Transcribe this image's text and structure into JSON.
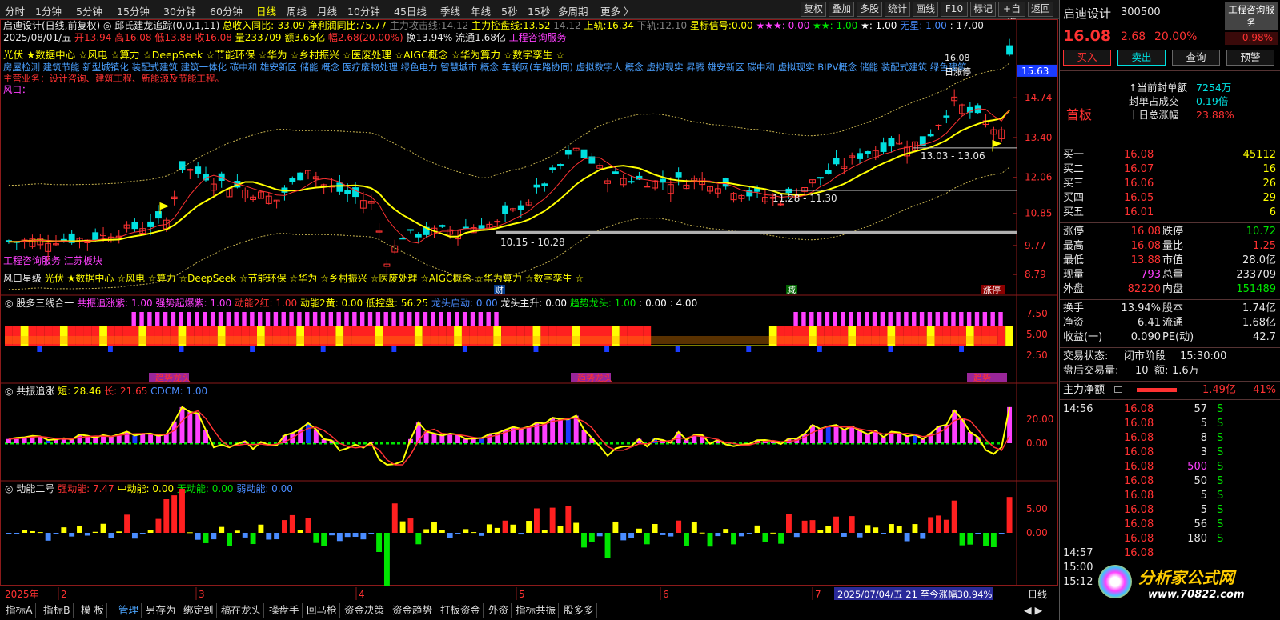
{
  "toolbar": {
    "periods": [
      "分时",
      "1分钟",
      "5分钟",
      "15分钟",
      "30分钟",
      "60分钟",
      "日线",
      "周线",
      "月线",
      "10分钟",
      "45日线",
      "季线",
      "年线",
      "5秒",
      "15秒",
      "多周期",
      "更多 〉"
    ],
    "active_period": "日线",
    "right_buttons": [
      "复权",
      "叠加",
      "多股",
      "统计",
      "画线",
      "F10",
      "标记",
      "+自选",
      "返回"
    ]
  },
  "stock": {
    "name": "启迪设计",
    "code": "300500",
    "chart_title": "启迪设计(日线,前复权)",
    "indicator_line": "邱氏建龙追踪(0,0,1,11)",
    "metrics_line1": [
      {
        "label": "总收入同比:",
        "value": "-33.09",
        "color": "#ffff00"
      },
      {
        "label": "净利润同比:",
        "value": "75.77",
        "color": "#ffff00"
      },
      {
        "label": "主力攻击线:",
        "value": "14.12",
        "color": "#808080"
      },
      {
        "label": "主力控盘线:",
        "value": "13.52",
        "color": "#ffff00"
      },
      {
        "label": "",
        "value": "14.12",
        "color": "#808080"
      },
      {
        "label": "上轨:",
        "value": "16.34",
        "color": "#ffff00"
      },
      {
        "label": "下轨:",
        "value": "12.10",
        "color": "#808080"
      },
      {
        "label": "星标信号:",
        "value": "0.00",
        "color": "#ffff00"
      }
    ],
    "stars": [
      {
        "text": "★★★:",
        "value": "0.00",
        "color": "#ff40ff"
      },
      {
        "text": "★★:",
        "value": "1.00",
        "color": "#00e600"
      },
      {
        "text": "★:",
        "value": "1.00",
        "color": "#ffffff"
      },
      {
        "text": "无星:",
        "value": "1.00",
        "color": "#4a8cff"
      }
    ],
    "extra_value": "17.00",
    "date_line": "2025/08/01/五",
    "ohlc": {
      "open": "13.94",
      "high": "16.08",
      "low": "13.88",
      "close": "16.08",
      "volume": "233709",
      "amount": "3.65亿",
      "change_pct": "2.68(20.00%)",
      "turnover": "13.94%",
      "float_shares": "1.68亿",
      "sector": "工程咨询服务"
    },
    "concepts_line": "光伏 ★数据中心 ☆风电 ☆算力 ☆DeepSeek ☆节能环保 ☆华为 ☆乡村振兴 ☆医废处理 ☆AIGC概念 ☆华为算力 ☆数字孪生 ☆",
    "tags_line": "房屋检测 建筑节能 新型城镇化 装配式建筑 建筑一体化 碳中和 雄安新区 储能 概念 医疗废物处理 绿色电力 智慧城市 概念 车联网(车路协同) 虚拟数字人 概念 虚拟现实 昇腾 雄安新区 碳中和 虚拟现实 BIPV概念 储能 装配式建筑 绿色建筑",
    "business": "主营业务：设计咨询、建筑工程、新能源及节能工程。",
    "wind": "风口：",
    "sector_tag": "工程咨询服务 江苏板块",
    "wind_tags_label": "风口星级",
    "wind_tags": "光伏 ★数据中心 ☆风电 ☆算力 ☆DeepSeek ☆节能环保 ☆华为 ☆乡村振兴 ☆医废处理 ☆AIGC概念 ☆华为算力 ☆数字孪生 ☆"
  },
  "price_axis": [
    "15.63",
    "14.74",
    "13.40",
    "12.06",
    "10.85",
    "9.77",
    "8.79"
  ],
  "price_axis_top": "15.63",
  "annotations": {
    "high": "16.08",
    "range1": "13.03 - 13.06",
    "range2": "11.28 - 11.30",
    "range3": "10.15 - 10.28",
    "mark_cai": "财",
    "mark_jian": "减",
    "mark_zhangting": "涨停",
    "rizhangting": "日涨停"
  },
  "panel2": {
    "title": "股多三线合一",
    "items": [
      {
        "label": "共振追涨紫:",
        "value": "1.00",
        "color": "#ff40ff"
      },
      {
        "label": "强势起爆紫:",
        "value": "1.00",
        "color": "#ff40ff"
      },
      {
        "label": "动能2红:",
        "value": "1.00",
        "color": "#ff3232"
      },
      {
        "label": "动能2黄:",
        "value": "0.00",
        "color": "#ffff00"
      },
      {
        "label": "低控盘:",
        "value": "56.25",
        "color": "#ffff00"
      },
      {
        "label": "龙头启动:",
        "value": "0.00",
        "color": "#4a8cff"
      },
      {
        "label": "龙头主升:",
        "value": "0.00",
        "color": "#ffffff"
      },
      {
        "label": "趋势龙头:",
        "value": "1.00",
        "color": "#00e600"
      },
      {
        "label": ":",
        "value": "0.00",
        "color": "#ffffff"
      },
      {
        "label": ":",
        "value": "4.00",
        "color": "#ffffff"
      }
    ],
    "axis": [
      "7.50",
      "5.00",
      "2.50"
    ],
    "labels": [
      "趋势龙头",
      "趋势龙头",
      "趋势"
    ]
  },
  "panel3": {
    "title": "共振追涨",
    "items": [
      {
        "label": "短:",
        "value": "28.46",
        "color": "#ffff00"
      },
      {
        "label": "长:",
        "value": "21.65",
        "color": "#ff3232"
      },
      {
        "label": "CDCM:",
        "value": "1.00",
        "color": "#4a8cff"
      }
    ],
    "axis": [
      "20.00",
      "0.00"
    ]
  },
  "panel4": {
    "title": "动能二号",
    "items": [
      {
        "label": "强动能:",
        "value": "7.47",
        "color": "#ff3232"
      },
      {
        "label": "中动能:",
        "value": "0.00",
        "color": "#ffff00"
      },
      {
        "label": "无动能:",
        "value": "0.00",
        "color": "#00e600"
      },
      {
        "label": "弱动能:",
        "value": "0.00",
        "color": "#4a8cff"
      }
    ],
    "axis": [
      "5.00",
      "0.00"
    ]
  },
  "time_axis": {
    "year": "2025年",
    "months": [
      "2",
      "3",
      "4",
      "5",
      "6",
      "7"
    ],
    "info": "2025/07/04/五 21 至今涨幅30.94%",
    "period_label": "日线"
  },
  "bottom_tabs": [
    "指标A",
    "指标B",
    "模 板",
    "管理",
    "另存为",
    "绑定到",
    "稿在龙头",
    "操盘手",
    "回马枪",
    "资金决策",
    "资金趋势",
    "打板资金",
    "外资",
    "指标共振",
    "股多多"
  ],
  "bottom_active": "管理",
  "right_panel": {
    "name": "启迪设计",
    "code": "300500",
    "price": "16.08",
    "change": "2.68",
    "pct": "20.00%",
    "corner_label": "工程咨询服务",
    "corner_pct": "0.98%",
    "buttons": [
      "买入",
      "卖出",
      "查询",
      "预警"
    ],
    "fb_label": "首板",
    "seal_rows": [
      {
        "label": "当前封单额",
        "value": "7254万"
      },
      {
        "label": "封单占成交",
        "value": "0.19倍"
      },
      {
        "label": "十日总涨幅",
        "value": "23.88%"
      }
    ],
    "bids": [
      {
        "label": "买一",
        "price": "16.08",
        "vol": "45112"
      },
      {
        "label": "买二",
        "price": "16.07",
        "vol": "16"
      },
      {
        "label": "买三",
        "price": "16.06",
        "vol": "26"
      },
      {
        "label": "买四",
        "price": "16.05",
        "vol": "29"
      },
      {
        "label": "买五",
        "price": "16.01",
        "vol": "6"
      }
    ],
    "stats": [
      {
        "l1": "涨停",
        "v1": "16.08",
        "c1": "#ff3232",
        "l2": "跌停",
        "v2": "10.72",
        "c2": "#00e600"
      },
      {
        "l1": "最高",
        "v1": "16.08",
        "c1": "#ff3232",
        "l2": "量比",
        "v2": "1.25",
        "c2": "#ff3232"
      },
      {
        "l1": "最低",
        "v1": "13.88",
        "c1": "#ff3232",
        "l2": "市值",
        "v2": "28.0亿",
        "c2": "#e6e6e6"
      },
      {
        "l1": "现量",
        "v1": "793",
        "c1": "#ff40ff",
        "l2": "总量",
        "v2": "233709",
        "c2": "#e6e6e6"
      },
      {
        "l1": "外盘",
        "v1": "82220",
        "c1": "#ff3232",
        "l2": "内盘",
        "v2": "151489",
        "c2": "#00e600"
      }
    ],
    "stats2": [
      {
        "l1": "换手",
        "v1": "13.94%",
        "l2": "股本",
        "v2": "1.74亿"
      },
      {
        "l1": "净资",
        "v1": "6.41",
        "l2": "流通",
        "v2": "1.68亿"
      },
      {
        "l1": "收益(一)",
        "v1": "0.090",
        "l2": "PE(动)",
        "v2": "42.7"
      }
    ],
    "trade_state_label": "交易状态:",
    "trade_state": "闭市阶段",
    "trade_time": "15:30:00",
    "after_vol_label": "盘后交易量:",
    "after_vol": "10",
    "after_amt_label": "额:",
    "after_amt": "1.6万",
    "net_label": "主力净额",
    "net_value": "1.49亿",
    "net_pct": "41%",
    "ticks": [
      {
        "time": "14:56",
        "price": "16.08",
        "vol": "57",
        "side": "S",
        "vcolor": "#e6e6e6"
      },
      {
        "time": "",
        "price": "16.08",
        "vol": "5",
        "side": "S",
        "vcolor": "#e6e6e6"
      },
      {
        "time": "",
        "price": "16.08",
        "vol": "8",
        "side": "S",
        "vcolor": "#e6e6e6"
      },
      {
        "time": "",
        "price": "16.08",
        "vol": "3",
        "side": "S",
        "vcolor": "#e6e6e6"
      },
      {
        "time": "",
        "price": "16.08",
        "vol": "500",
        "side": "S",
        "vcolor": "#ff40ff"
      },
      {
        "time": "",
        "price": "16.08",
        "vol": "50",
        "side": "S",
        "vcolor": "#e6e6e6"
      },
      {
        "time": "",
        "price": "16.08",
        "vol": "5",
        "side": "S",
        "vcolor": "#e6e6e6"
      },
      {
        "time": "",
        "price": "16.08",
        "vol": "5",
        "side": "S",
        "vcolor": "#e6e6e6"
      },
      {
        "time": "",
        "price": "16.08",
        "vol": "56",
        "side": "S",
        "vcolor": "#e6e6e6"
      },
      {
        "time": "",
        "price": "16.08",
        "vol": "180",
        "side": "S",
        "vcolor": "#e6e6e6"
      },
      {
        "time": "14:57",
        "price": "16.08",
        "vol": "",
        "side": "",
        "vcolor": "#e6e6e6"
      },
      {
        "time": "15:00",
        "price": "",
        "vol": "",
        "side": "",
        "vcolor": "#e6e6e6"
      },
      {
        "time": "15:12",
        "price": "",
        "vol": "",
        "side": "",
        "vcolor": "#e6e6e6"
      }
    ],
    "watermark": "分析家公式网",
    "watermark_url": "www.70822.com"
  },
  "colors": {
    "up": "#ff3232",
    "down": "#00e0e0",
    "ma": "#ffff00",
    "panel_magenta": "#ff40ff"
  }
}
